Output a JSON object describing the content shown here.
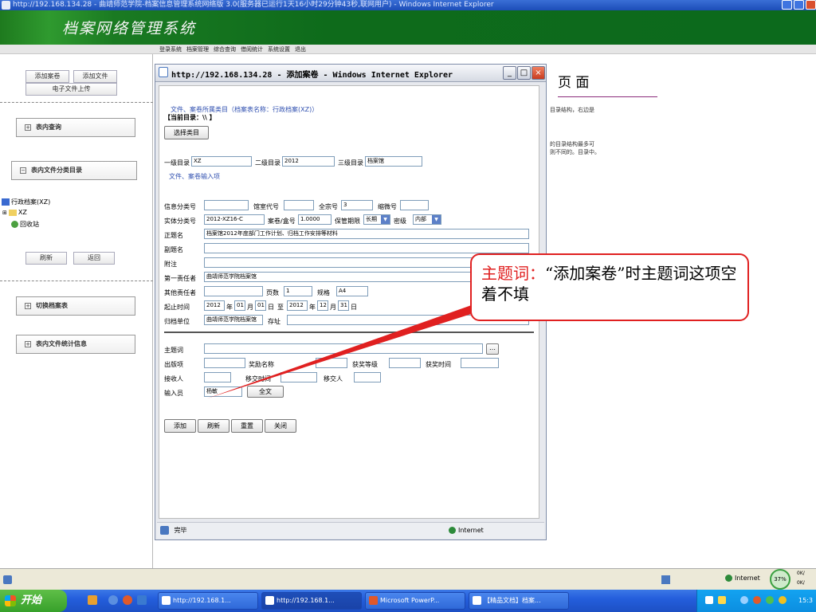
{
  "outer_window": {
    "title": "http://192.168.134.28 - 曲靖师范学院-档案信息管理系统网络版 3.0(服务器已运行1天16小时29分钟43秒,联网用户) - Windows Internet Explorer"
  },
  "banner": {
    "title": "档案网络管理系统"
  },
  "nav": {
    "items": [
      "登录系统",
      "档案管理",
      "综合查询",
      "借阅统计",
      "系统设置",
      "退出"
    ]
  },
  "sidebar": {
    "add_volume": "添加案卷",
    "add_file": "添加文件",
    "upload_e": "电子文件上传",
    "panel_query": "表内查询",
    "panel_catalog": "表内文件分类目录",
    "tree_root": "行政档案(XZ)",
    "tree_child": "XZ",
    "tree_recycle": "回收站",
    "refresh": "刷新",
    "back": "返回",
    "panel_switch": "切换档案表",
    "panel_stats": "表内文件统计信息"
  },
  "bg_page": {
    "title": "页 面",
    "lines": [
      "目录结构，右边是",
      "的目录结构最多可",
      "则不同的。目录中。"
    ]
  },
  "popup": {
    "title": "http://192.168.134.28 - 添加案卷 - Windows Internet Explorer",
    "section_catalog": "文件、案卷所属类目（档案表名称：行政档案(XZ)）",
    "current_dir": "【当前目录：\\\\ 】",
    "choose_btn": "选择类目",
    "lv1_label": "一级目录",
    "lv1_value": "XZ",
    "lv2_label": "二级目录",
    "lv2_value": "2012",
    "lv3_label": "三级目录",
    "lv3_value": "档案馆",
    "section_input": "文件、案卷输入项",
    "info_class_label": "信息分类号",
    "info_class_value": "",
    "room_code_label": "馆室代号",
    "room_code_value": "",
    "fonds_label": "全宗号",
    "fonds_value": "3",
    "micro_label": "缩微号",
    "micro_value": "",
    "entity_label": "实体分类号",
    "entity_value": "2012-XZ16-C",
    "box_label": "案卷/盒号",
    "box_value": "1.0000",
    "period_label": "保管期限",
    "period_value": "长期",
    "secret_label": "密级",
    "secret_value": "内部",
    "title_label": "正题名",
    "title_value": "档案馆2012年度部门工作计划、归档工作安排等材料",
    "subtitle_label": "副题名",
    "subtitle_value": "",
    "note_label": "附注",
    "note_value": "",
    "resp_label": "第一责任者",
    "resp_value": "曲靖师范学院档案馆",
    "other_label": "其他责任者",
    "other_value": "",
    "pages_label": "页数",
    "pages_value": "1",
    "spec_label": "规格",
    "spec_value": "A4",
    "date_label": "起止时间",
    "date_y1": "2012",
    "year_l1": "年",
    "date_m1": "01",
    "month_l1": "月",
    "date_d1": "01",
    "day_l1": "日",
    "to_l": "至",
    "date_y2": "2012",
    "year_l2": "年",
    "date_m2": "12",
    "month_l2": "月",
    "date_d2": "31",
    "day_l2": "日",
    "archive_label": "归档单位",
    "archive_value": "曲靖师范学院档案馆",
    "addr_label": "存址",
    "addr_value": "",
    "subject_label": "主题词",
    "subject_value": "",
    "pub_label": "出版项",
    "pub_value": "",
    "award_label": "奖励名称",
    "award_value": "",
    "award_lvl_label": "获奖等级",
    "award_lvl_value": "",
    "award_time_label": "获奖时间",
    "award_time_value": "",
    "recv_label": "接收人",
    "recv_value": "",
    "trans_time_label": "移交时间",
    "trans_time_value": "",
    "trans_person_label": "移交人",
    "trans_person_value": "",
    "input_label": "输入员",
    "input_value": "杨敏",
    "fulltext_btn": "全文",
    "btn_add": "添加",
    "btn_refresh": "刷新",
    "btn_reset": "重置",
    "btn_close": "关闭",
    "status_done": "完毕",
    "status_zone": "Internet"
  },
  "callout": {
    "key": "主题词：",
    "text": "“添加案卷”时主题词这项空着不填"
  },
  "outer_status": {
    "zone": "Internet",
    "percent": "37%",
    "up": "0K/",
    "down": "0K/"
  },
  "taskbar": {
    "start": "开始",
    "tasks": [
      "http://192.168.1...",
      "http://192.168.1...",
      "Microsoft PowerP...",
      "【精品文档】档案..."
    ],
    "clock": "15:3"
  },
  "colors": {
    "banner": "#0c6a1c",
    "callout_border": "#e02020",
    "link_blue": "#3050b0"
  }
}
